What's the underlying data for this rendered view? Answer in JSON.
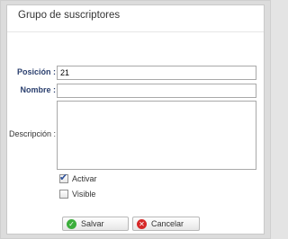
{
  "dialog": {
    "title": "Grupo de suscriptores"
  },
  "form": {
    "posicion_label": "Posición :",
    "posicion_value": "21",
    "nombre_label": "Nombre :",
    "nombre_value": "",
    "descripcion_label": "Descripción :",
    "descripcion_value": "",
    "activar_label": "Activar",
    "activar_checked": true,
    "visible_label": "Visible",
    "visible_checked": false
  },
  "buttons": {
    "save_label": "Salvar",
    "cancel_label": "Cancelar"
  },
  "icons": {
    "save_icon": "check-icon",
    "cancel_icon": "close-icon"
  },
  "colors": {
    "label_bold": "#2a3f6e",
    "save_icon_bg": "#3cae3c",
    "cancel_icon_bg": "#d62828",
    "check_mark": "#2b4f9a"
  }
}
